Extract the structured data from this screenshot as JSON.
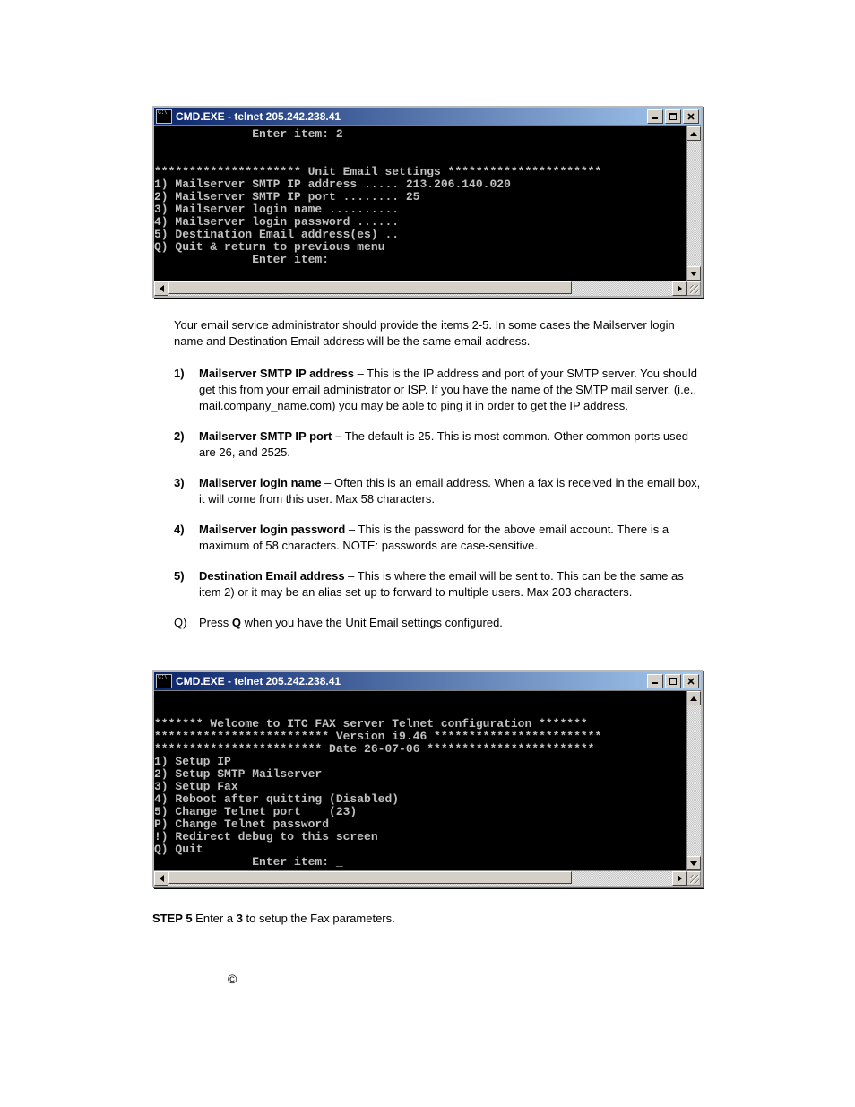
{
  "window1": {
    "title": "CMD.EXE - telnet 205.242.238.41",
    "lines": {
      "l0": "              Enter item: 2",
      "l1": "",
      "l2": "",
      "l3": "********************* Unit Email settings **********************",
      "l4": "1) Mailserver SMTP IP address ..... 213.206.140.020",
      "l5": "2) Mailserver SMTP IP port ........ 25",
      "l6": "3) Mailserver login name ..........",
      "l7": "4) Mailserver login password ......",
      "l8": "5) Destination Email address(es) ..",
      "l9": "Q) Quit & return to previous menu",
      "l10": "              Enter item:",
      "l11": "",
      "l12": ""
    }
  },
  "intro": "Your email service administrator should provide the items 2-5. In some cases the Mailserver login name and Destination Email address will be the same email address.",
  "items": [
    {
      "marker": "1)",
      "title": "Mailserver SMTP IP address",
      "sep": " – ",
      "text": "This is the IP address and port of your SMTP server. You should get this from your email administrator or ISP. If you have the name of the SMTP mail server, (i.e., mail.company_name.com) you may be able to ping it in order to get the IP address."
    },
    {
      "marker": "2)",
      "title": "Mailserver SMTP IP port –",
      "sep": " ",
      "text": "The default is 25. This is most common. Other common ports used are 26, and 2525."
    },
    {
      "marker": "3)",
      "title": "Mailserver login name",
      "sep": " – ",
      "text": "Often this is an email address. When a fax is received in the email box, it will come from this user.  Max 58 characters."
    },
    {
      "marker": "4)",
      "title": "Mailserver login password",
      "sep": " – ",
      "text": "This is the password for the above email account. There is a maximum of 58 characters. NOTE: passwords are case-sensitive."
    },
    {
      "marker": "5)",
      "title": "Destination Email address",
      "sep": " – ",
      "text": "This is where the email will be sent to. This can be the same as item 2) or it may be an alias set up to forward to multiple users.  Max 203 characters."
    }
  ],
  "q_item": {
    "marker": "Q)",
    "pre": "Press ",
    "key": "Q",
    "post": " when you have the Unit Email settings configured."
  },
  "window2": {
    "title": "CMD.EXE - telnet 205.242.238.41",
    "lines": {
      "l0": "",
      "l1": "",
      "l2": "******* Welcome to ITC FAX server Telnet configuration *******",
      "l3": "************************* Version i9.46 ************************",
      "l4": "************************ Date 26-07-06 ************************",
      "l5": "1) Setup IP",
      "l6": "2) Setup SMTP Mailserver",
      "l7": "3) Setup Fax",
      "l8": "4) Reboot after quitting (Disabled)",
      "l9": "5) Change Telnet port    (23)",
      "l10": "P) Change Telnet password",
      "l11": "!) Redirect debug to this screen",
      "l12": "Q) Quit",
      "l13": "              Enter item: _"
    }
  },
  "step5": {
    "label": "STEP 5",
    "pre": " Enter a ",
    "key": "3",
    "post": " to setup the Fax parameters."
  },
  "copyright": "©"
}
